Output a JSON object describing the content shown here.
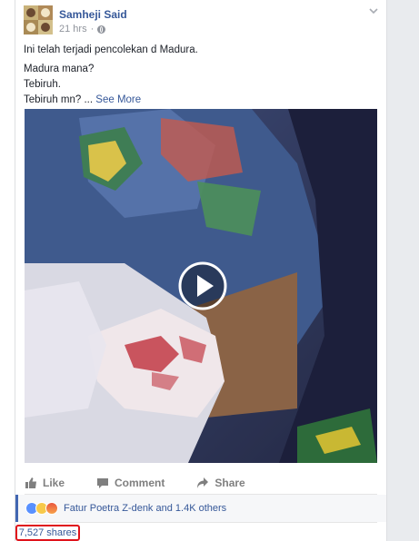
{
  "post": {
    "author": "Samheji Said",
    "time": "21 hrs",
    "dot": "·",
    "text_line1": "Ini telah terjadi pencolekan d Madura.",
    "text_line2": "Madura mana?",
    "text_line3": "Tebiruh.",
    "text_line4": "Tebiruh mn? ...",
    "see_more": "See More"
  },
  "actions": {
    "like": "Like",
    "comment": "Comment",
    "share": "Share"
  },
  "reactions": {
    "icons": [
      "like-icon",
      "sad-icon",
      "angry-icon"
    ],
    "summary": "Fatur Poetra Z-denk and 1.4K others"
  },
  "shares": "7,527 shares",
  "colors": {
    "link": "#365899",
    "highlight": "#e0121b",
    "accent_bar": "#4267b2"
  }
}
